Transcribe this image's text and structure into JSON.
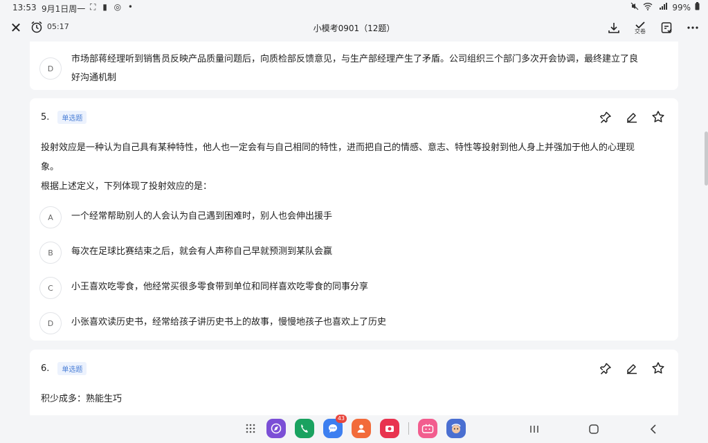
{
  "status_bar": {
    "time": "13:53",
    "date": "9月1日周一",
    "battery": "99%"
  },
  "top_bar": {
    "timer": "05:17",
    "title": "小模考0901（12题）",
    "submit_label": "交卷"
  },
  "prev_question": {
    "option_d": {
      "letter": "D",
      "line1": "市场部蒋经理听到销售员反映产品质量问题后，向质检部反馈意见，与生产部经理产生了矛盾。公司组织三个部门多次开会协调，最终建立了良",
      "line2": "好沟通机制"
    }
  },
  "question5": {
    "number": "5.",
    "type": "单选题",
    "stem_line1": "投射效应是一种认为自己具有某种特性，他人也一定会有与自己相同的特性，进而把自己的情感、意志、特性等投射到他人身上并强加于他人的心理现",
    "stem_line2": "象。",
    "stem_line3": "根据上述定义，下列体现了投射效应的是：",
    "options": [
      {
        "letter": "A",
        "text": "一个经常帮助别人的人会认为自己遇到困难时，别人也会伸出援手"
      },
      {
        "letter": "B",
        "text": "每次在足球比赛结束之后，就会有人声称自己早就预测到某队会赢"
      },
      {
        "letter": "C",
        "text": "小王喜欢吃零食，他经常买很多零食带到单位和同样喜欢吃零食的同事分享"
      },
      {
        "letter": "D",
        "text": "小张喜欢读历史书，经常给孩子讲历史书上的故事，慢慢地孩子也喜欢上了历史"
      }
    ]
  },
  "question6": {
    "number": "6.",
    "type": "单选题",
    "stem": "积少成多：熟能生巧"
  },
  "dock": {
    "notification_count": "43"
  },
  "colors": {
    "background": "#f4f5f7",
    "card": "#ffffff",
    "tag_text": "#4a7fd6",
    "tag_bg": "#ecf2fd"
  }
}
